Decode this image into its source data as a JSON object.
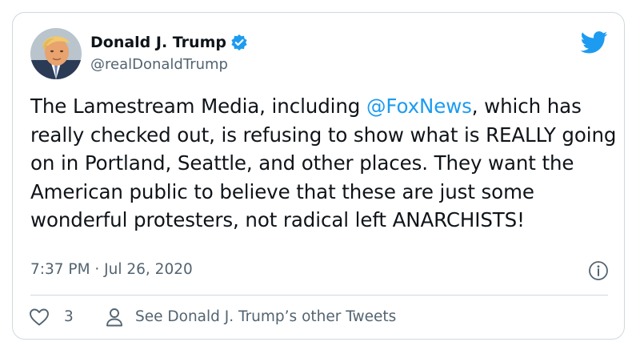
{
  "author": {
    "display_name": "Donald J. Trump",
    "handle": "@realDonaldTrump",
    "verified": true
  },
  "tweet": {
    "text_before": "The Lamestream Media, including ",
    "mention": "@FoxNews",
    "text_after": ", which has really checked out, is refusing to show what is REALLY going on in Portland, Seattle, and other places. They want the American public to believe that these are just some wonderful protesters, not radical left ANARCHISTS!",
    "timestamp": "7:37 PM · Jul 26, 2020"
  },
  "actions": {
    "like_count": "3",
    "see_more_label": "See Donald J. Trump’s other Tweets"
  },
  "icons": {
    "brand": "twitter-bird-icon",
    "verified": "verified-badge-icon",
    "info": "info-icon",
    "like": "heart-icon",
    "profile": "person-icon"
  },
  "colors": {
    "accent": "#1d9bf0",
    "text": "#0f1419",
    "muted": "#536471",
    "border": "#cfd9de"
  }
}
